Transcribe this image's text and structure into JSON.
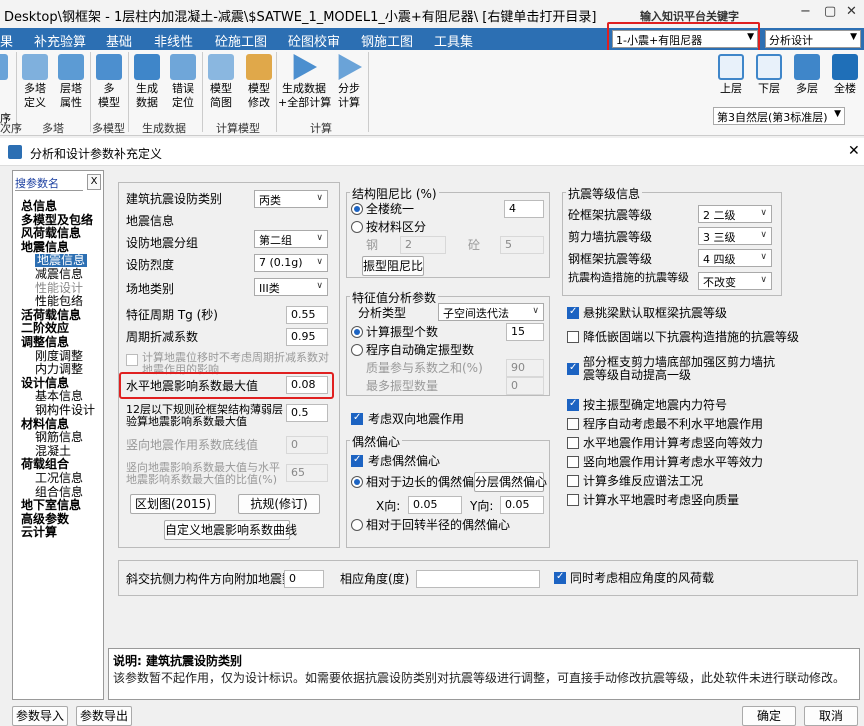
{
  "window": {
    "title": "Desktop\\钢框架 - 1层柱内加混凝土-减震\\$SATWE_1_MODEL1_小震+有阻尼器\\ [右键单击打开目录]",
    "search_placeholder": "输入知识平台关键字",
    "minimize": "−",
    "restore": "▢",
    "close": "✕"
  },
  "menu": [
    "果",
    "补充验算",
    "基础",
    "非线性",
    "砼施工图",
    "砼图校审",
    "钢施工图",
    "工具集"
  ],
  "model_combo": "1-小震+有阻尼器",
  "design_combo": "分析设计",
  "ribbon": {
    "buttons": [
      {
        "label": "多塔\n定义"
      },
      {
        "label": "层塔\n属性"
      },
      {
        "label": "多\n模型"
      },
      {
        "label": "生成\n数据"
      },
      {
        "label": "错误\n定位"
      },
      {
        "label": "模型\n简图"
      },
      {
        "label": "模型\n修改"
      },
      {
        "label": "生成数据\n+全部计算"
      },
      {
        "label": "分步\n计算"
      }
    ],
    "groups": [
      "次序",
      "多塔",
      "多模型",
      "生成数据",
      "计算模型",
      "计算"
    ],
    "view_buttons": [
      "上层",
      "下层",
      "多层",
      "全楼"
    ],
    "story_combo": "第3自然层(第3标准层)",
    "story_prefix": "序"
  },
  "dialog": {
    "title": "分析和设计参数补充定义",
    "close": "✕",
    "search_label": "搜参数名",
    "search_clear": "X",
    "tree": [
      {
        "t": "总信息",
        "s": "b"
      },
      {
        "t": "多模型及包络",
        "s": "b"
      },
      {
        "t": "风荷载信息",
        "s": "b"
      },
      {
        "t": "地震信息",
        "s": "b"
      },
      {
        "t": "地震信息",
        "s": "sel"
      },
      {
        "t": "减震信息",
        "s": ""
      },
      {
        "t": "性能设计",
        "s": "dis"
      },
      {
        "t": "性能包络",
        "s": ""
      },
      {
        "t": "活荷载信息",
        "s": "b"
      },
      {
        "t": "二阶效应",
        "s": "b"
      },
      {
        "t": "调整信息",
        "s": "b"
      },
      {
        "t": "刚度调整",
        "s": ""
      },
      {
        "t": "内力调整",
        "s": ""
      },
      {
        "t": "设计信息",
        "s": "b"
      },
      {
        "t": "基本信息",
        "s": ""
      },
      {
        "t": "钢构件设计",
        "s": ""
      },
      {
        "t": "材料信息",
        "s": "b"
      },
      {
        "t": "钢筋信息",
        "s": ""
      },
      {
        "t": "混凝土",
        "s": ""
      },
      {
        "t": "荷载组合",
        "s": "b"
      },
      {
        "t": "工况信息",
        "s": ""
      },
      {
        "t": "组合信息",
        "s": ""
      },
      {
        "t": "地下室信息",
        "s": "b"
      },
      {
        "t": "高级参数",
        "s": "b"
      },
      {
        "t": "云计算",
        "s": "b"
      }
    ],
    "col1": {
      "building_class_label": "建筑抗震设防类别",
      "building_class": "丙类",
      "seis_info_title": "地震信息",
      "group_label": "设防地震分组",
      "group": "第二组",
      "intensity_label": "设防烈度",
      "intensity": "7 (0.1g)",
      "site_label": "场地类别",
      "site": "III类",
      "tg_label": "特征周期 Tg (秒)",
      "tg": "0.55",
      "period_label": "周期折减系数",
      "period": "0.95",
      "nodisp_label": "计算地震位移时不考虑周期折减系数对地震作用的影响",
      "amax_label": "水平地震影响系数最大值",
      "amax": "0.08",
      "weak_label": "12层以下规则砼框架结构薄弱层验算地震影响系数最大值",
      "weak": "0.5",
      "vert_label": "竖向地震作用系数底线值",
      "vert": "0",
      "vratio_label": "竖向地震影响系数最大值与水平地震影响系数最大值的比值(%)",
      "vratio": "65",
      "btn_zone": "区划图(2015)",
      "btn_code": "抗规(修订)",
      "btn_curve": "自定义地震影响系数曲线"
    },
    "col2": {
      "damp_title": "结构阻尼比 (%)",
      "unified_label": "全楼统一",
      "unified": "4",
      "bymat_label": "按材料区分",
      "steel_label": "钢",
      "steel": "2",
      "conc_label": "砼",
      "conc": "5",
      "btn_mode_damp": "振型阻尼比",
      "eig_title": "特征值分析参数",
      "type_label": "分析类型",
      "type": "子空间迭代法",
      "modes_label": "计算振型个数",
      "modes": "15",
      "auto_label": "程序自动确定振型数",
      "mass_label": "质量参与系数之和(%)",
      "mass": "90",
      "max_label": "最多振型数量",
      "max": "0",
      "bidir_label": "考虑双向地震作用",
      "acc_title": "偶然偏心",
      "acc_label": "考虑偶然偏心",
      "side_label": "相对于边长的偶然偏心",
      "btn_floor_ecc": "分层偶然偏心",
      "x_label": "X向:",
      "x": "0.05",
      "y_label": "Y向:",
      "y": "0.05",
      "gyr_label": "相对于回转半径的偶然偏心"
    },
    "col3": {
      "grade_title": "抗震等级信息",
      "conc_frame_label": "砼框架抗震等级",
      "conc_frame": "2  二级",
      "shear_label": "剪力墙抗震等级",
      "shear": "3  三级",
      "steel_frame_label": "钢框架抗震等级",
      "steel_frame": "4  四级",
      "measure_label": "抗震构造措施的抗震等级",
      "measure": "不改变",
      "opt1": "悬挑梁默认取框梁抗震等级",
      "opt2": "降低嵌固端以下抗震构造措施的抗震等级",
      "opt3": "部分框支剪力墙底部加强区剪力墙抗震等级自动提高一级",
      "opt4": "按主振型确定地震内力符号",
      "opt5": "程序自动考虑最不利水平地震作用",
      "opt6": "水平地震作用计算考虑竖向等效力",
      "opt7": "竖向地震作用计算考虑水平等效力",
      "opt8": "计算多维反应谱法工况",
      "opt9": "计算水平地震时考虑竖向质量"
    },
    "bottom": {
      "oblique_label": "斜交抗侧力构件方向附加地震数",
      "oblique": "0",
      "angle_label": "相应角度(度)",
      "angle": "",
      "wind_label": "同时考虑相应角度的风荷载"
    },
    "desc": {
      "head": "说明: 建筑抗震设防类别",
      "body": "该参数暂不起作用，仅为设计标识。如需要依据抗震设防类别对抗震等级进行调整，可直接手动修改抗震等级，此处软件未进行联动修改。"
    },
    "footer": {
      "import": "参数导入",
      "export": "参数导出",
      "ok": "确定",
      "cancel": "取消"
    }
  }
}
